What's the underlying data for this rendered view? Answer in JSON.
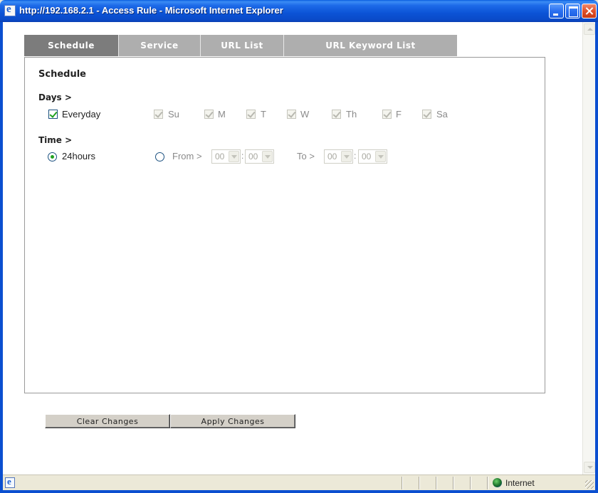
{
  "window": {
    "title": "http://192.168.2.1 - Access Rule - Microsoft Internet Explorer"
  },
  "tabs": [
    {
      "label": "Schedule",
      "active": true
    },
    {
      "label": "Service",
      "active": false
    },
    {
      "label": "URL List",
      "active": false
    },
    {
      "label": "URL Keyword List",
      "active": false
    }
  ],
  "schedule": {
    "title": "Schedule",
    "days_label": "Days >",
    "everyday_label": "Everyday",
    "everyday_checked": true,
    "days": [
      {
        "label": "Su",
        "checked": true
      },
      {
        "label": "M",
        "checked": true
      },
      {
        "label": "T",
        "checked": true
      },
      {
        "label": "W",
        "checked": true
      },
      {
        "label": "Th",
        "checked": true
      },
      {
        "label": "F",
        "checked": true
      },
      {
        "label": "Sa",
        "checked": true
      }
    ],
    "time_label": "Time >",
    "hours24_label": "24hours",
    "from_label": "From >",
    "to_label": "To >",
    "colon": ":",
    "from_hour": "00",
    "from_min": "00",
    "to_hour": "00",
    "to_min": "00",
    "selected_time_mode": "24hours"
  },
  "buttons": {
    "clear": "Clear Changes",
    "apply": "Apply Changes"
  },
  "statusbar": {
    "zone": "Internet"
  }
}
